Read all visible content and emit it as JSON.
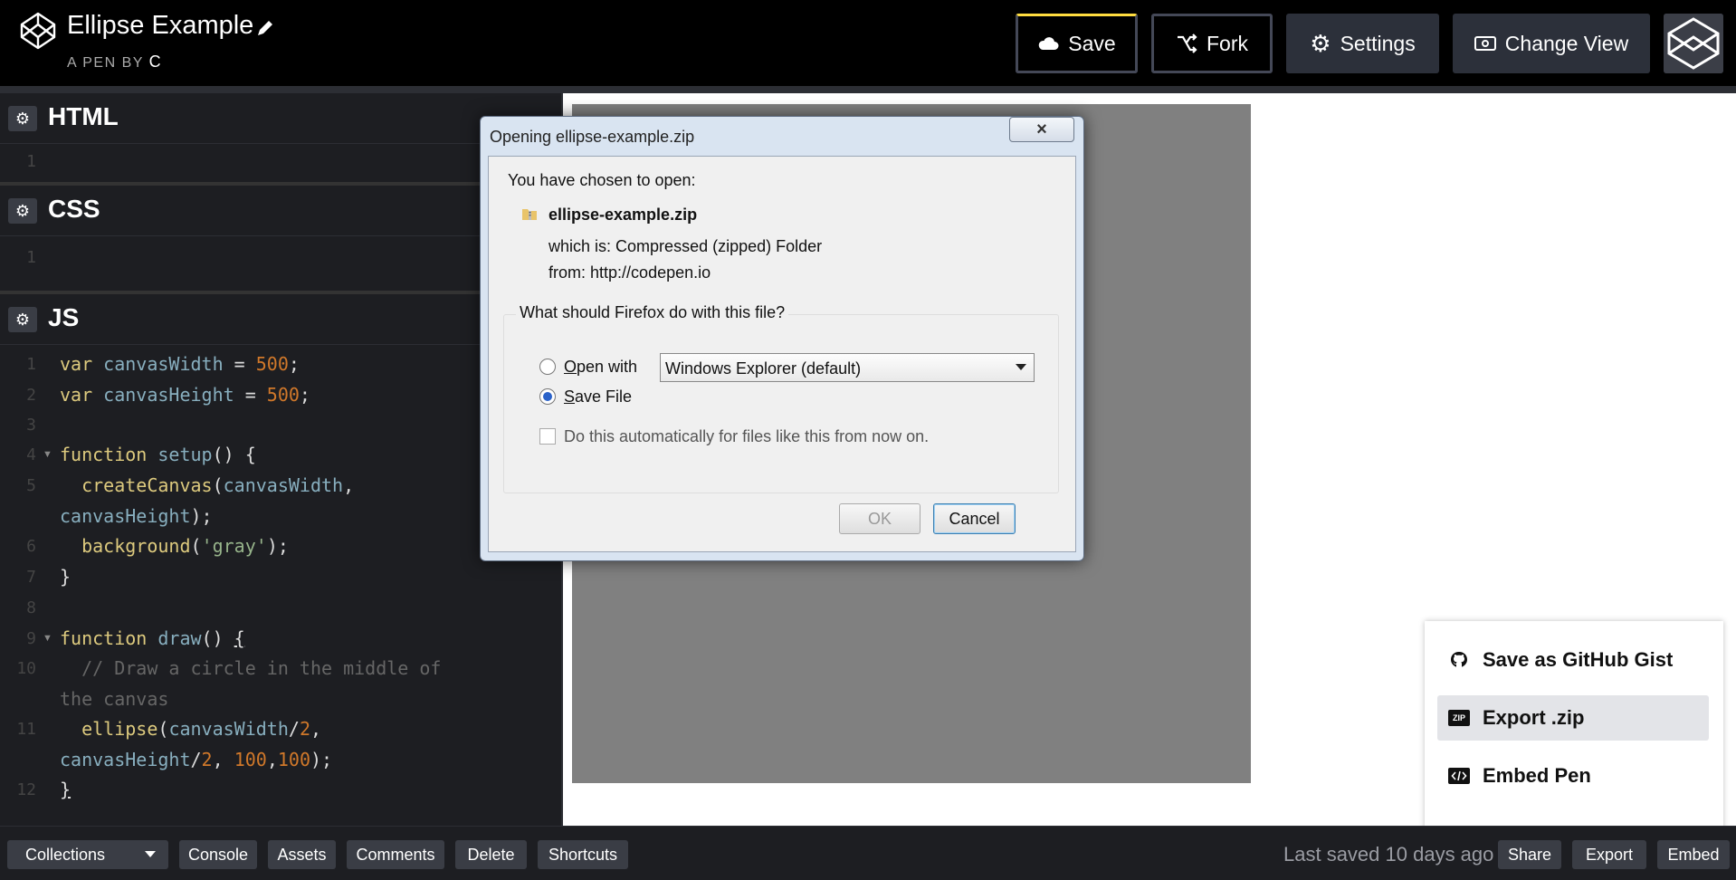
{
  "header": {
    "title": "Ellipse Example",
    "byline_prefix": "A PEN BY",
    "byline_author": "C",
    "buttons": {
      "save": "Save",
      "fork": "Fork",
      "settings": "Settings",
      "change_view": "Change View"
    },
    "accent_color": "#ffdd40"
  },
  "editors": {
    "html": {
      "name": "HTML",
      "lines": [
        "1"
      ]
    },
    "css": {
      "name": "CSS",
      "lines": [
        "1"
      ]
    },
    "js": {
      "name": "JS"
    }
  },
  "footer": {
    "collections": "Collections",
    "console": "Console",
    "assets": "Assets",
    "comments": "Comments",
    "delete": "Delete",
    "shortcuts": "Shortcuts",
    "last_saved": "Last saved 10 days ago",
    "share": "Share",
    "export": "Export",
    "embed": "Embed"
  },
  "export_menu": {
    "items": [
      "Save as GitHub Gist",
      "Export .zip",
      "Embed Pen"
    ],
    "active": "Export .zip",
    "zip_icon_text": "ZIP"
  },
  "dialog": {
    "title": "Opening ellipse-example.zip",
    "close": "×",
    "chosen": "You have chosen to open:",
    "filename": "ellipse-example.zip",
    "which_is_label": "which is:",
    "which_is_value": "Compressed (zipped) Folder",
    "from_label": "from:",
    "from_value": "http://codepen.io",
    "question": "What should Firefox do with this file?",
    "open_with_label": "Open with",
    "open_with_value": "Windows Explorer (default)",
    "save_file_label": "Save File",
    "selected": "save_file",
    "auto_label": "Do this automatically for files like this from now on.",
    "auto_checked": false,
    "ok": "OK",
    "cancel": "Cancel"
  }
}
